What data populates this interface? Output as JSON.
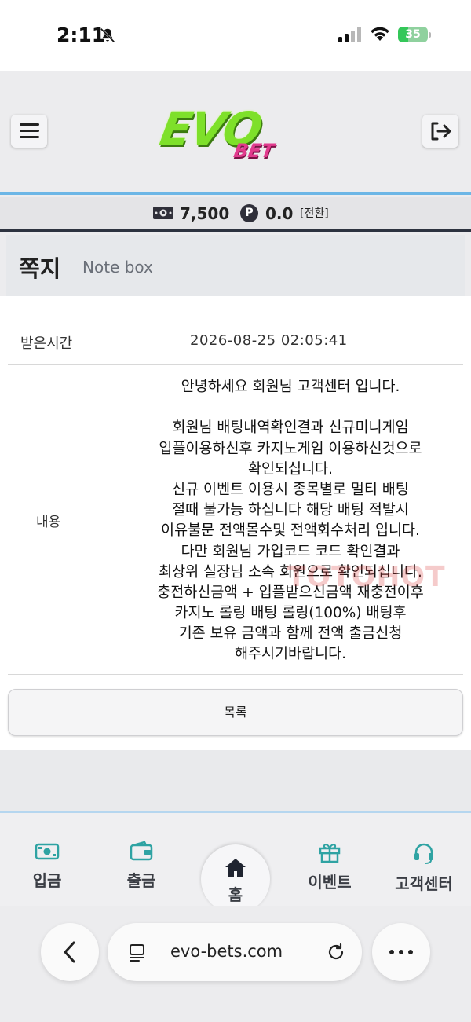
{
  "status_bar": {
    "time": "2:11",
    "battery": "35",
    "battery_level": 0.35
  },
  "header": {
    "logo_main": "EVO",
    "logo_sub": "BET"
  },
  "balance": {
    "cash": "7,500",
    "point_icon": "P",
    "point": "0.0",
    "convert": "[전환]"
  },
  "note": {
    "title": "쪽지",
    "subtitle": "Note box"
  },
  "message": {
    "time_label": "받은시간",
    "time_value": "2026-08-25 02:05:41",
    "body_label": "내용",
    "lines": [
      "안녕하세요 회원님 고객센터 입니다.",
      "",
      "회원님 배팅내역확인결과 신규미니게임",
      "입플이용하신후 카지노게임 이용하신것으로",
      "확인되십니다.",
      "신규 이벤트 이용시 종목별로 멀티 배팅",
      "절때 불가능 하십니다 해당 배팅 적발시",
      "이유불문 전액몰수및 전액회수처리 입니다.",
      "다만 회원님 가입코드 코드 확인결과",
      "최상위 실장님 소속 회원으로 확인되십니다.",
      "충전하신금액 + 입플받으신금액 재충전이후",
      "카지노 롤링 배팅 롤링(100%) 배팅후",
      "기존 보유 금액과 함께 전액 출금신청",
      "해주시기바랍니다."
    ],
    "watermark": "TOTOHOT",
    "list_button": "목록"
  },
  "bottom_nav": {
    "deposit": "입금",
    "withdraw": "출금",
    "home": "홈",
    "event": "이벤트",
    "support": "고객센터"
  },
  "browser": {
    "url": "evo-bets.com"
  },
  "colors": {
    "accent_blue": "#6cb6e6",
    "nav_icon": "#2fa3a3",
    "logo_green": "#7ee02a",
    "logo_pink": "#e23b8e"
  }
}
